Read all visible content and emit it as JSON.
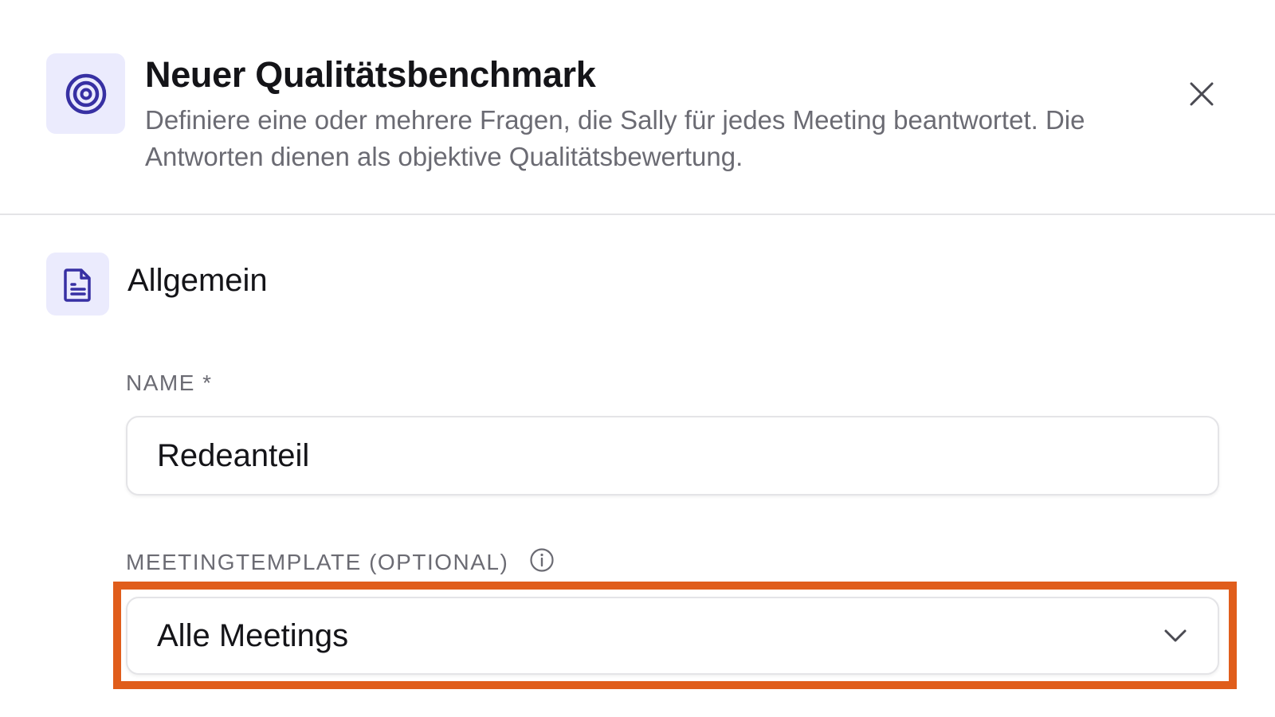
{
  "dialog": {
    "title": "Neuer Qualitätsbenchmark",
    "description": "Definiere eine oder mehrere Fragen, die Sally für jedes Meeting beantwortet. Die Antworten dienen als objektive Qualitätsbewertung.",
    "header_icon": "target-icon",
    "close_icon": "close-icon"
  },
  "section": {
    "title": "Allgemein",
    "icon": "document-icon"
  },
  "fields": {
    "name": {
      "label": "NAME *",
      "value": "Redeanteil"
    },
    "template": {
      "label": "MEETINGTEMPLATE (OPTIONAL)",
      "info_icon": "info-icon",
      "selected": "Alle Meetings",
      "chevron_icon": "chevron-down-icon"
    }
  },
  "colors": {
    "accent": "#3730a3",
    "icon_tile_bg": "#ebebfd",
    "highlight": "#e05d1b",
    "muted_text": "#6b6b73"
  }
}
